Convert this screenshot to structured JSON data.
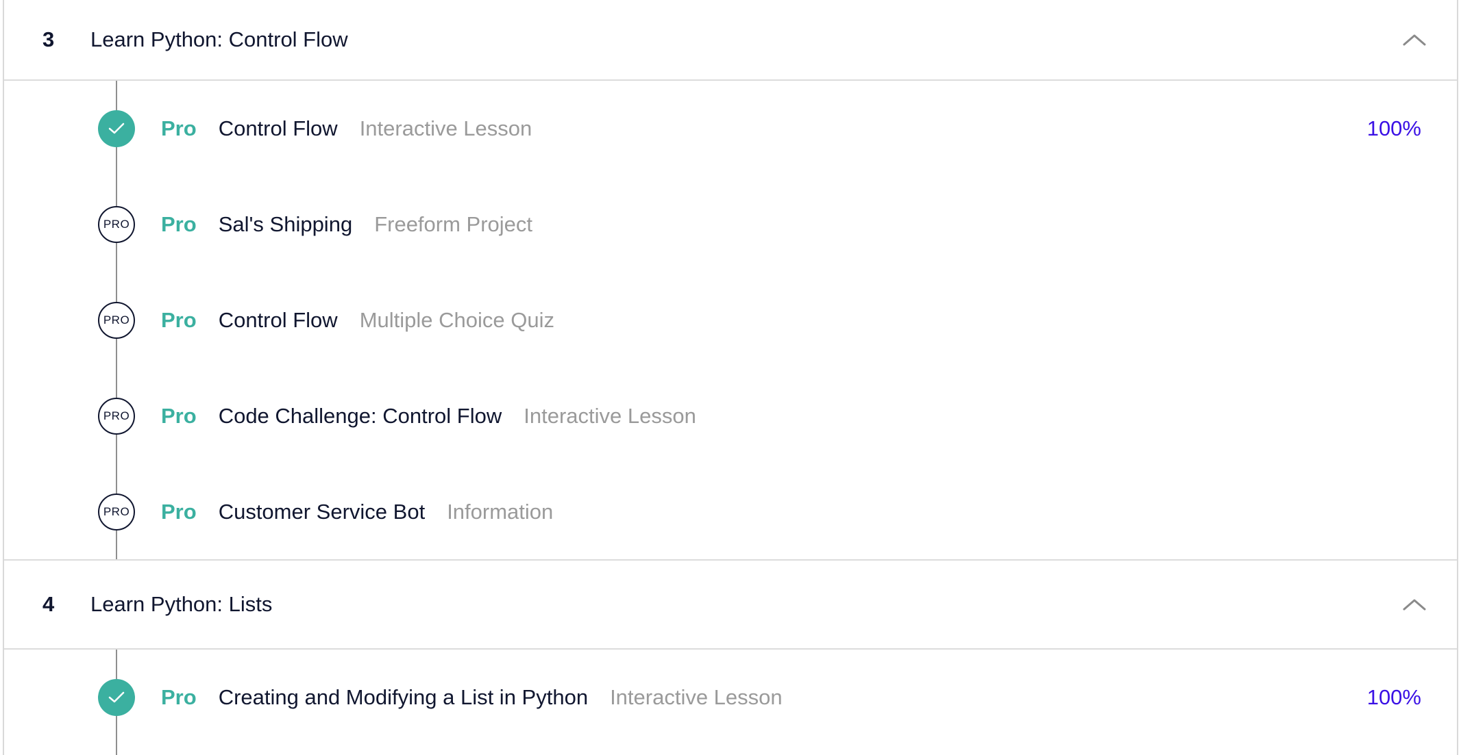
{
  "sections": [
    {
      "number": "3",
      "title": "Learn Python: Control Flow",
      "items": [
        {
          "status": "complete",
          "node_text": "",
          "pro": "Pro",
          "name": "Control Flow",
          "type": "Interactive Lesson",
          "progress": "100%"
        },
        {
          "status": "locked",
          "node_text": "PRO",
          "pro": "Pro",
          "name": "Sal's Shipping",
          "type": "Freeform Project",
          "progress": ""
        },
        {
          "status": "locked",
          "node_text": "PRO",
          "pro": "Pro",
          "name": "Control Flow",
          "type": "Multiple Choice Quiz",
          "progress": ""
        },
        {
          "status": "locked",
          "node_text": "PRO",
          "pro": "Pro",
          "name": "Code Challenge: Control Flow",
          "type": "Interactive Lesson",
          "progress": ""
        },
        {
          "status": "locked",
          "node_text": "PRO",
          "pro": "Pro",
          "name": "Customer Service Bot",
          "type": "Information",
          "progress": ""
        }
      ]
    },
    {
      "number": "4",
      "title": "Learn Python: Lists",
      "items": [
        {
          "status": "complete",
          "node_text": "",
          "pro": "Pro",
          "name": "Creating and Modifying a List in Python",
          "type": "Interactive Lesson",
          "progress": "100%"
        }
      ]
    }
  ],
  "icons": {
    "complete": "checkmark-icon",
    "locked": "pro-badge-icon",
    "collapse": "chevron-up-icon"
  },
  "colors": {
    "accent_teal": "#3bb0a0",
    "progress_purple": "#3a10e5",
    "text_dark": "#10162f",
    "text_muted": "#9a9a9a"
  }
}
